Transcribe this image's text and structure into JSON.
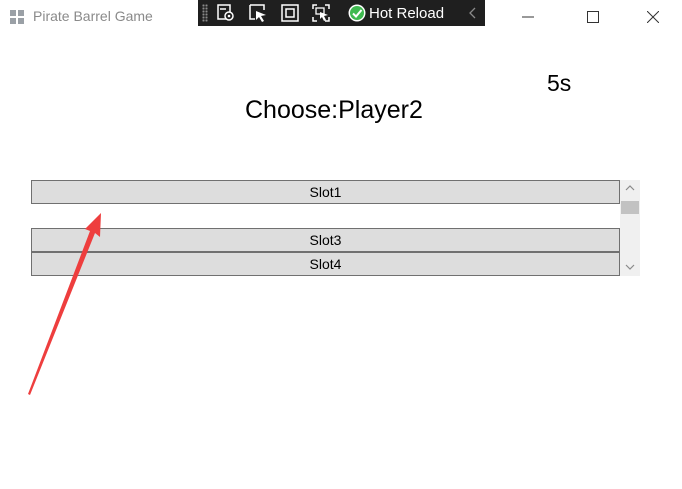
{
  "window": {
    "title": "Pirate Barrel Game",
    "controls": [
      "minimize-icon",
      "maximize-icon",
      "close-icon"
    ]
  },
  "debug_toolbar": {
    "icons": [
      "live-visual-tree-icon",
      "select-element-icon",
      "display-layout-adorners-icon",
      "track-focused-element-icon",
      "hot-reload-ok-icon",
      "collapse-chevron-icon"
    ],
    "hot_reload_label": "Hot Reload"
  },
  "game": {
    "countdown": "5s",
    "choose_label": "Choose:Player2"
  },
  "slot_list": {
    "slots": [
      "Slot1",
      "Slot3",
      "Slot4"
    ]
  },
  "colors": {
    "annotation_arrow": "#ee3e3e",
    "toolbar_bg": "#1f1f1f",
    "hot_reload_check": "#3fb950",
    "slot_bg": "#dddddd"
  }
}
